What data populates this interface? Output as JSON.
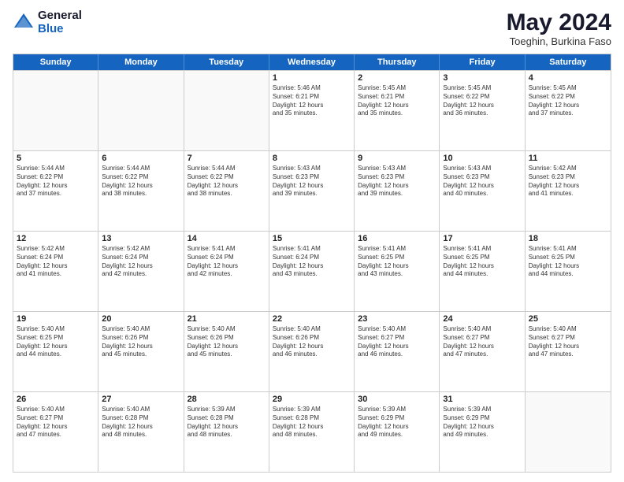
{
  "header": {
    "logo_general": "General",
    "logo_blue": "Blue",
    "month_title": "May 2024",
    "location": "Toeghin, Burkina Faso"
  },
  "weekdays": [
    "Sunday",
    "Monday",
    "Tuesday",
    "Wednesday",
    "Thursday",
    "Friday",
    "Saturday"
  ],
  "rows": [
    [
      {
        "day": "",
        "text": "",
        "empty": true
      },
      {
        "day": "",
        "text": "",
        "empty": true
      },
      {
        "day": "",
        "text": "",
        "empty": true
      },
      {
        "day": "1",
        "text": "Sunrise: 5:46 AM\nSunset: 6:21 PM\nDaylight: 12 hours\nand 35 minutes.",
        "empty": false
      },
      {
        "day": "2",
        "text": "Sunrise: 5:45 AM\nSunset: 6:21 PM\nDaylight: 12 hours\nand 35 minutes.",
        "empty": false
      },
      {
        "day": "3",
        "text": "Sunrise: 5:45 AM\nSunset: 6:22 PM\nDaylight: 12 hours\nand 36 minutes.",
        "empty": false
      },
      {
        "day": "4",
        "text": "Sunrise: 5:45 AM\nSunset: 6:22 PM\nDaylight: 12 hours\nand 37 minutes.",
        "empty": false
      }
    ],
    [
      {
        "day": "5",
        "text": "Sunrise: 5:44 AM\nSunset: 6:22 PM\nDaylight: 12 hours\nand 37 minutes.",
        "empty": false
      },
      {
        "day": "6",
        "text": "Sunrise: 5:44 AM\nSunset: 6:22 PM\nDaylight: 12 hours\nand 38 minutes.",
        "empty": false
      },
      {
        "day": "7",
        "text": "Sunrise: 5:44 AM\nSunset: 6:22 PM\nDaylight: 12 hours\nand 38 minutes.",
        "empty": false
      },
      {
        "day": "8",
        "text": "Sunrise: 5:43 AM\nSunset: 6:23 PM\nDaylight: 12 hours\nand 39 minutes.",
        "empty": false
      },
      {
        "day": "9",
        "text": "Sunrise: 5:43 AM\nSunset: 6:23 PM\nDaylight: 12 hours\nand 39 minutes.",
        "empty": false
      },
      {
        "day": "10",
        "text": "Sunrise: 5:43 AM\nSunset: 6:23 PM\nDaylight: 12 hours\nand 40 minutes.",
        "empty": false
      },
      {
        "day": "11",
        "text": "Sunrise: 5:42 AM\nSunset: 6:23 PM\nDaylight: 12 hours\nand 41 minutes.",
        "empty": false
      }
    ],
    [
      {
        "day": "12",
        "text": "Sunrise: 5:42 AM\nSunset: 6:24 PM\nDaylight: 12 hours\nand 41 minutes.",
        "empty": false
      },
      {
        "day": "13",
        "text": "Sunrise: 5:42 AM\nSunset: 6:24 PM\nDaylight: 12 hours\nand 42 minutes.",
        "empty": false
      },
      {
        "day": "14",
        "text": "Sunrise: 5:41 AM\nSunset: 6:24 PM\nDaylight: 12 hours\nand 42 minutes.",
        "empty": false
      },
      {
        "day": "15",
        "text": "Sunrise: 5:41 AM\nSunset: 6:24 PM\nDaylight: 12 hours\nand 43 minutes.",
        "empty": false
      },
      {
        "day": "16",
        "text": "Sunrise: 5:41 AM\nSunset: 6:25 PM\nDaylight: 12 hours\nand 43 minutes.",
        "empty": false
      },
      {
        "day": "17",
        "text": "Sunrise: 5:41 AM\nSunset: 6:25 PM\nDaylight: 12 hours\nand 44 minutes.",
        "empty": false
      },
      {
        "day": "18",
        "text": "Sunrise: 5:41 AM\nSunset: 6:25 PM\nDaylight: 12 hours\nand 44 minutes.",
        "empty": false
      }
    ],
    [
      {
        "day": "19",
        "text": "Sunrise: 5:40 AM\nSunset: 6:25 PM\nDaylight: 12 hours\nand 44 minutes.",
        "empty": false
      },
      {
        "day": "20",
        "text": "Sunrise: 5:40 AM\nSunset: 6:26 PM\nDaylight: 12 hours\nand 45 minutes.",
        "empty": false
      },
      {
        "day": "21",
        "text": "Sunrise: 5:40 AM\nSunset: 6:26 PM\nDaylight: 12 hours\nand 45 minutes.",
        "empty": false
      },
      {
        "day": "22",
        "text": "Sunrise: 5:40 AM\nSunset: 6:26 PM\nDaylight: 12 hours\nand 46 minutes.",
        "empty": false
      },
      {
        "day": "23",
        "text": "Sunrise: 5:40 AM\nSunset: 6:27 PM\nDaylight: 12 hours\nand 46 minutes.",
        "empty": false
      },
      {
        "day": "24",
        "text": "Sunrise: 5:40 AM\nSunset: 6:27 PM\nDaylight: 12 hours\nand 47 minutes.",
        "empty": false
      },
      {
        "day": "25",
        "text": "Sunrise: 5:40 AM\nSunset: 6:27 PM\nDaylight: 12 hours\nand 47 minutes.",
        "empty": false
      }
    ],
    [
      {
        "day": "26",
        "text": "Sunrise: 5:40 AM\nSunset: 6:27 PM\nDaylight: 12 hours\nand 47 minutes.",
        "empty": false
      },
      {
        "day": "27",
        "text": "Sunrise: 5:40 AM\nSunset: 6:28 PM\nDaylight: 12 hours\nand 48 minutes.",
        "empty": false
      },
      {
        "day": "28",
        "text": "Sunrise: 5:39 AM\nSunset: 6:28 PM\nDaylight: 12 hours\nand 48 minutes.",
        "empty": false
      },
      {
        "day": "29",
        "text": "Sunrise: 5:39 AM\nSunset: 6:28 PM\nDaylight: 12 hours\nand 48 minutes.",
        "empty": false
      },
      {
        "day": "30",
        "text": "Sunrise: 5:39 AM\nSunset: 6:29 PM\nDaylight: 12 hours\nand 49 minutes.",
        "empty": false
      },
      {
        "day": "31",
        "text": "Sunrise: 5:39 AM\nSunset: 6:29 PM\nDaylight: 12 hours\nand 49 minutes.",
        "empty": false
      },
      {
        "day": "",
        "text": "",
        "empty": true
      }
    ]
  ]
}
